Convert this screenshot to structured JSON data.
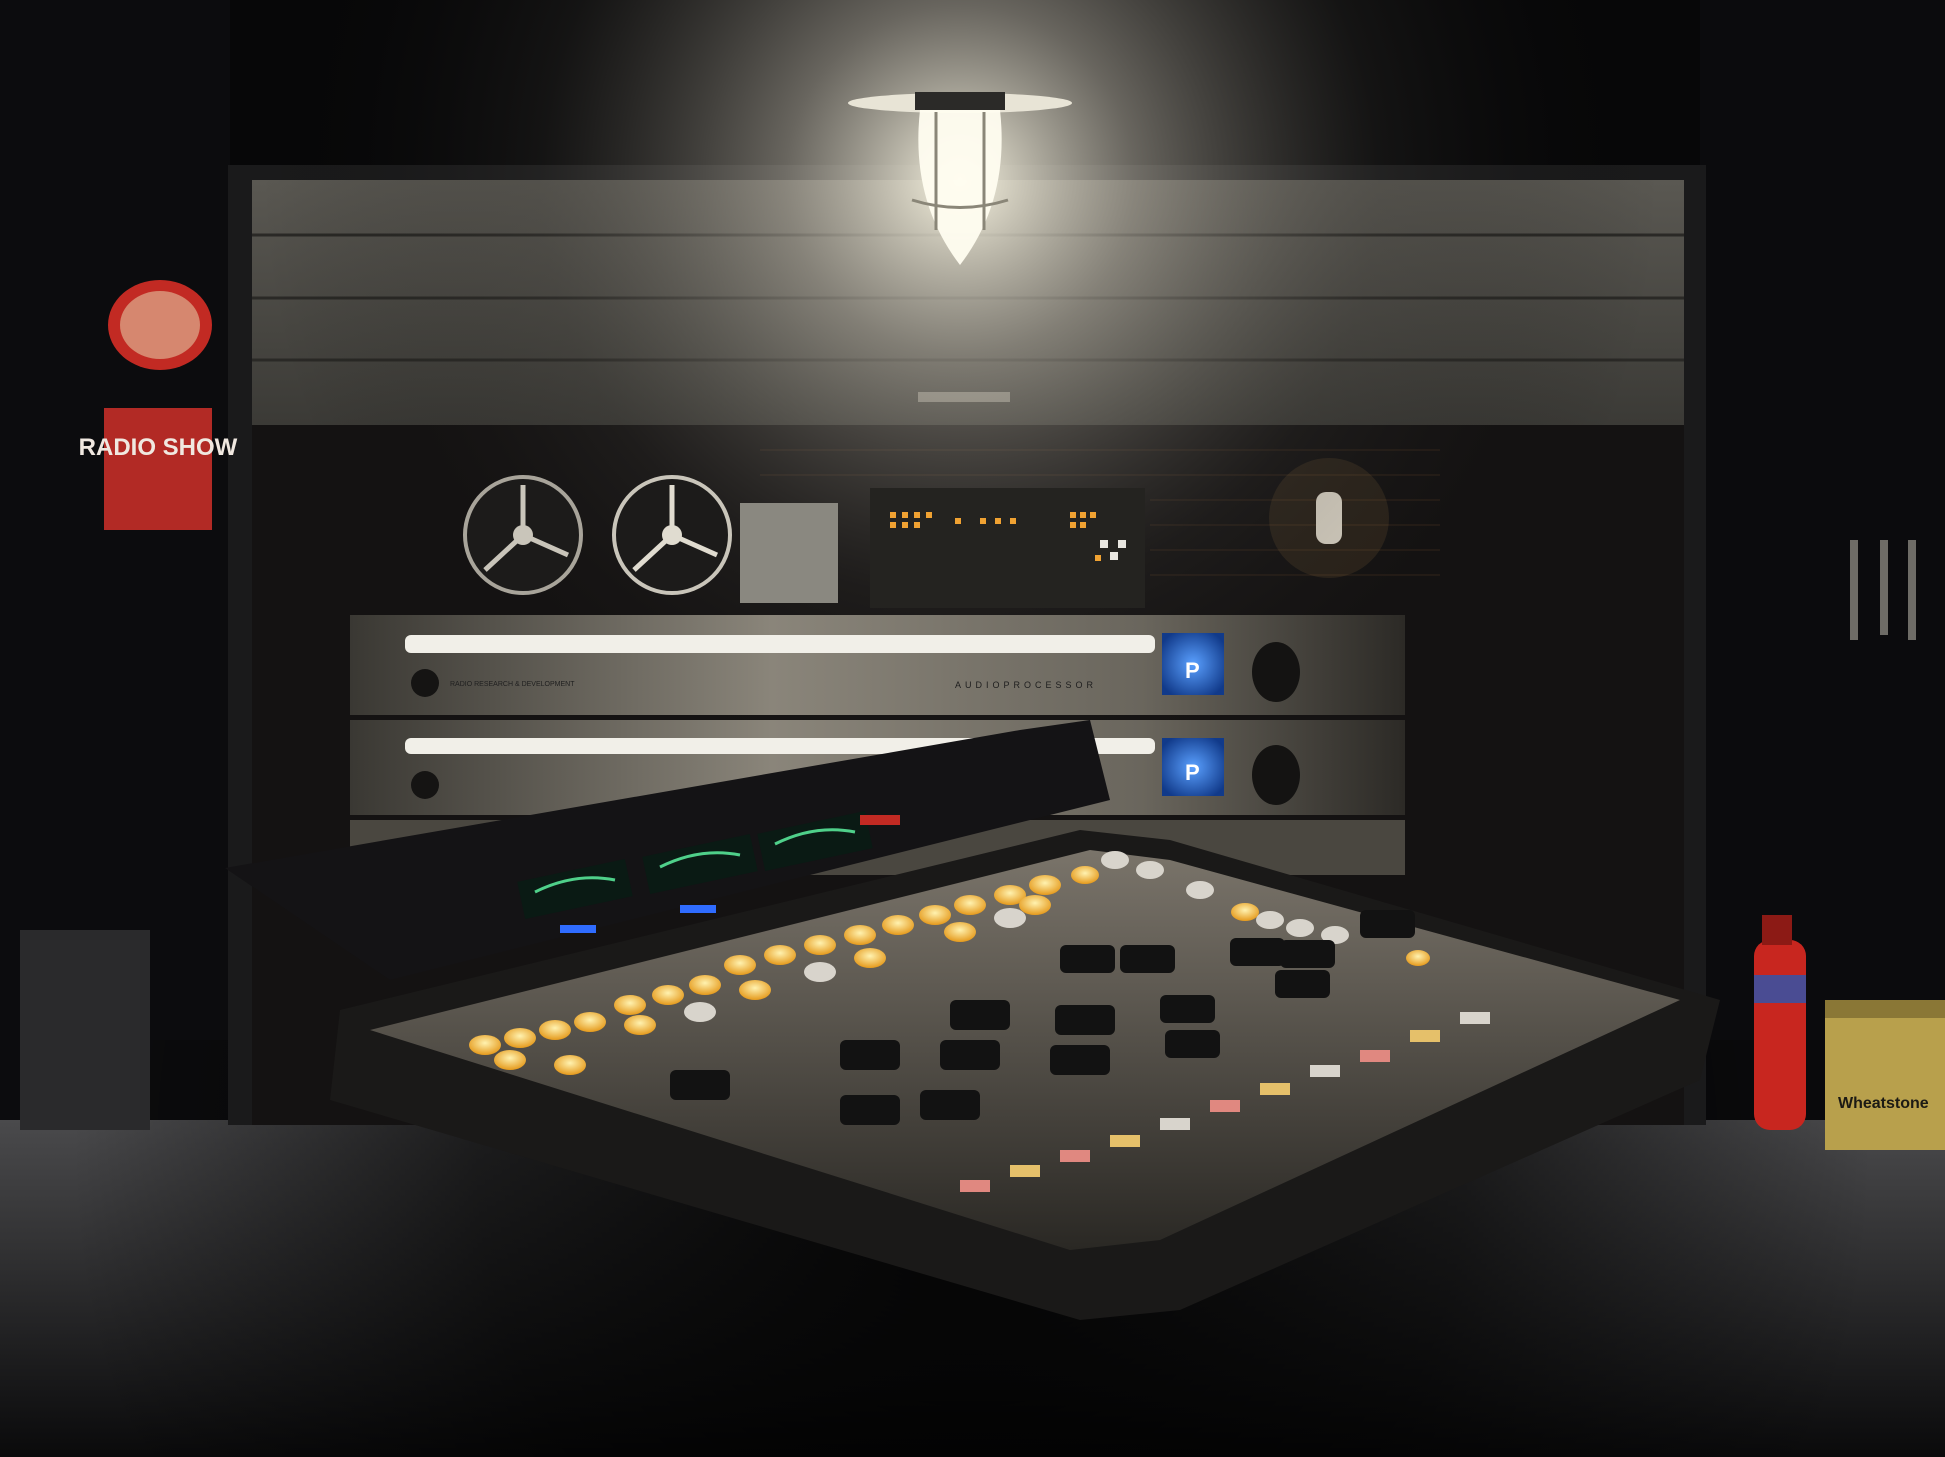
{
  "scene": {
    "description_free": true,
    "elements": {
      "lamp": "ceiling-lamp",
      "garage_door": "roller-door",
      "rack_units": 3,
      "console_lit_buttons": "amber",
      "fire_extinguisher": "red",
      "box_label": "Wheatstone"
    }
  },
  "signs": {
    "poster_top": "",
    "poster_text": "RADIO SHOW"
  },
  "rack": {
    "brand_text": "RADIO RESEARCH &\nDEVELOPMENT",
    "model_text": "AUDIOPROCESSOR"
  },
  "box": {
    "label": "Wheatstone"
  },
  "colors": {
    "amber": "#f4b63a",
    "blue_screen": "#2a6bd6",
    "extinguisher": "#c8261f",
    "box": "#b8a04c"
  }
}
